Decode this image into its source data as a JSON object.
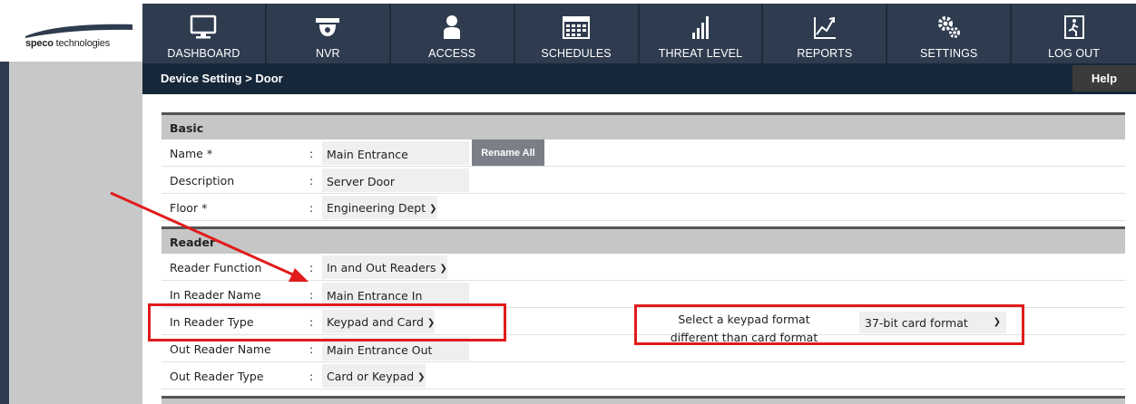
{
  "brand": {
    "name_bold": "speco",
    "name_rest": " technologies"
  },
  "nav": [
    {
      "label": "DASHBOARD",
      "icon": "monitor-icon"
    },
    {
      "label": "NVR",
      "icon": "dome-camera-icon"
    },
    {
      "label": "ACCESS",
      "icon": "user-icon"
    },
    {
      "label": "SCHEDULES",
      "icon": "calendar-icon"
    },
    {
      "label": "THREAT LEVEL",
      "icon": "signal-bars-icon"
    },
    {
      "label": "REPORTS",
      "icon": "report-chart-icon"
    },
    {
      "label": "SETTINGS",
      "icon": "gears-icon"
    },
    {
      "label": "LOG OUT",
      "icon": "exit-door-icon"
    }
  ],
  "breadcrumb": "Device Setting > Door",
  "help_label": "Help",
  "basic": {
    "title": "Basic",
    "name": {
      "label": "Name *",
      "value": "Main Entrance"
    },
    "rename_all": "Rename All",
    "description": {
      "label": "Description",
      "value": "Server Door"
    },
    "floor": {
      "label": "Floor *",
      "value": "Engineering Dept"
    }
  },
  "reader": {
    "title": "Reader",
    "reader_function": {
      "label": "Reader Function",
      "value": "In and Out Readers"
    },
    "in_reader_name": {
      "label": "In Reader Name",
      "value": "Main Entrance In"
    },
    "in_reader_type": {
      "label": "In Reader Type",
      "value": "Keypad and Card"
    },
    "keypad_format": {
      "label_line1": "Select a keypad format",
      "label_line2": "different than card format",
      "value": "37-bit card format"
    },
    "out_reader_name": {
      "label": "Out Reader Name",
      "value": "Main Entrance Out"
    },
    "out_reader_type": {
      "label": "Out Reader Type",
      "value": "Card or Keypad"
    }
  },
  "colon": ":",
  "colors": {
    "topbar": "#2f3c4f",
    "breadbar": "#16273a",
    "annotation": "#e11b1b"
  }
}
